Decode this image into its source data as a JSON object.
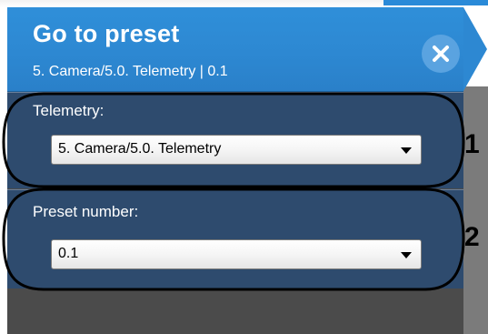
{
  "header": {
    "title": "Go to preset",
    "subtitle": "5. Camera/5.0. Telemetry | 0.1",
    "close_icon": "close-icon"
  },
  "telemetry": {
    "label": "Telemetry:",
    "selected": "5. Camera/5.0. Telemetry"
  },
  "preset": {
    "label": "Preset number:",
    "selected": "0.1"
  },
  "annotations": {
    "callout_1": "1",
    "callout_2": "2"
  },
  "colors": {
    "header_blue": "#2d88d2",
    "section_navy": "#2e4b6e",
    "panel_gray": "#4b4b4b"
  }
}
